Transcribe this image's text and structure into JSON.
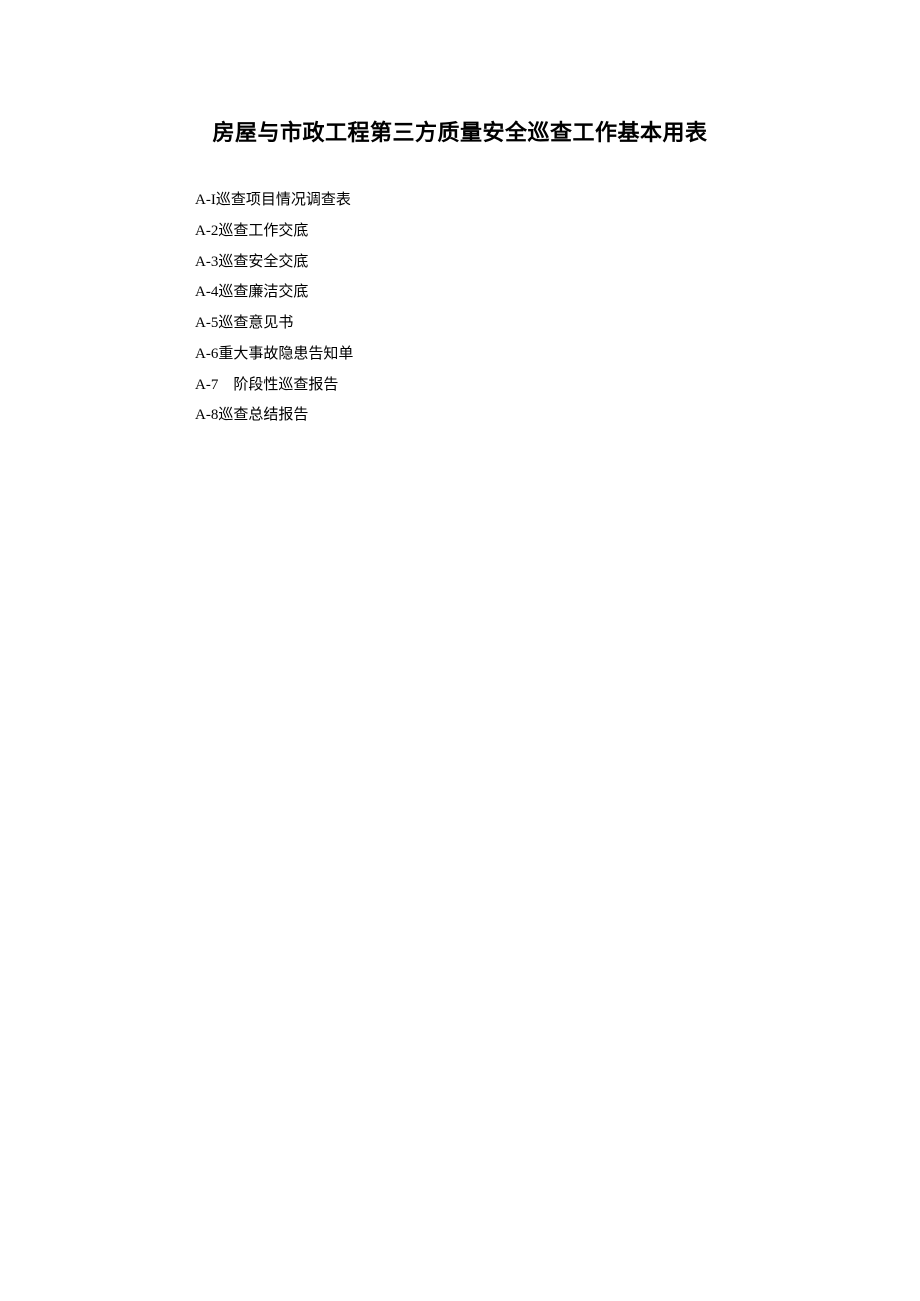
{
  "title": "房屋与市政工程第三方质量安全巡查工作基本用表",
  "items": [
    {
      "code": "A-I",
      "sep": " ",
      "label": "巡查项目情况调查表"
    },
    {
      "code": "A-2",
      "sep": " ",
      "label": "巡查工作交底"
    },
    {
      "code": "A-3",
      "sep": " ",
      "label": "巡查安全交底"
    },
    {
      "code": "A-4",
      "sep": " ",
      "label": "巡查廉洁交底"
    },
    {
      "code": "A-5",
      "sep": " ",
      "label": "巡查意见书"
    },
    {
      "code": "A-6",
      "sep": " ",
      "label": "重大事故隐患告知单"
    },
    {
      "code": "A-7",
      "sep": "  ",
      "label": "阶段性巡查报告"
    },
    {
      "code": "A-8",
      "sep": " ",
      "label": "巡查总结报告"
    }
  ]
}
